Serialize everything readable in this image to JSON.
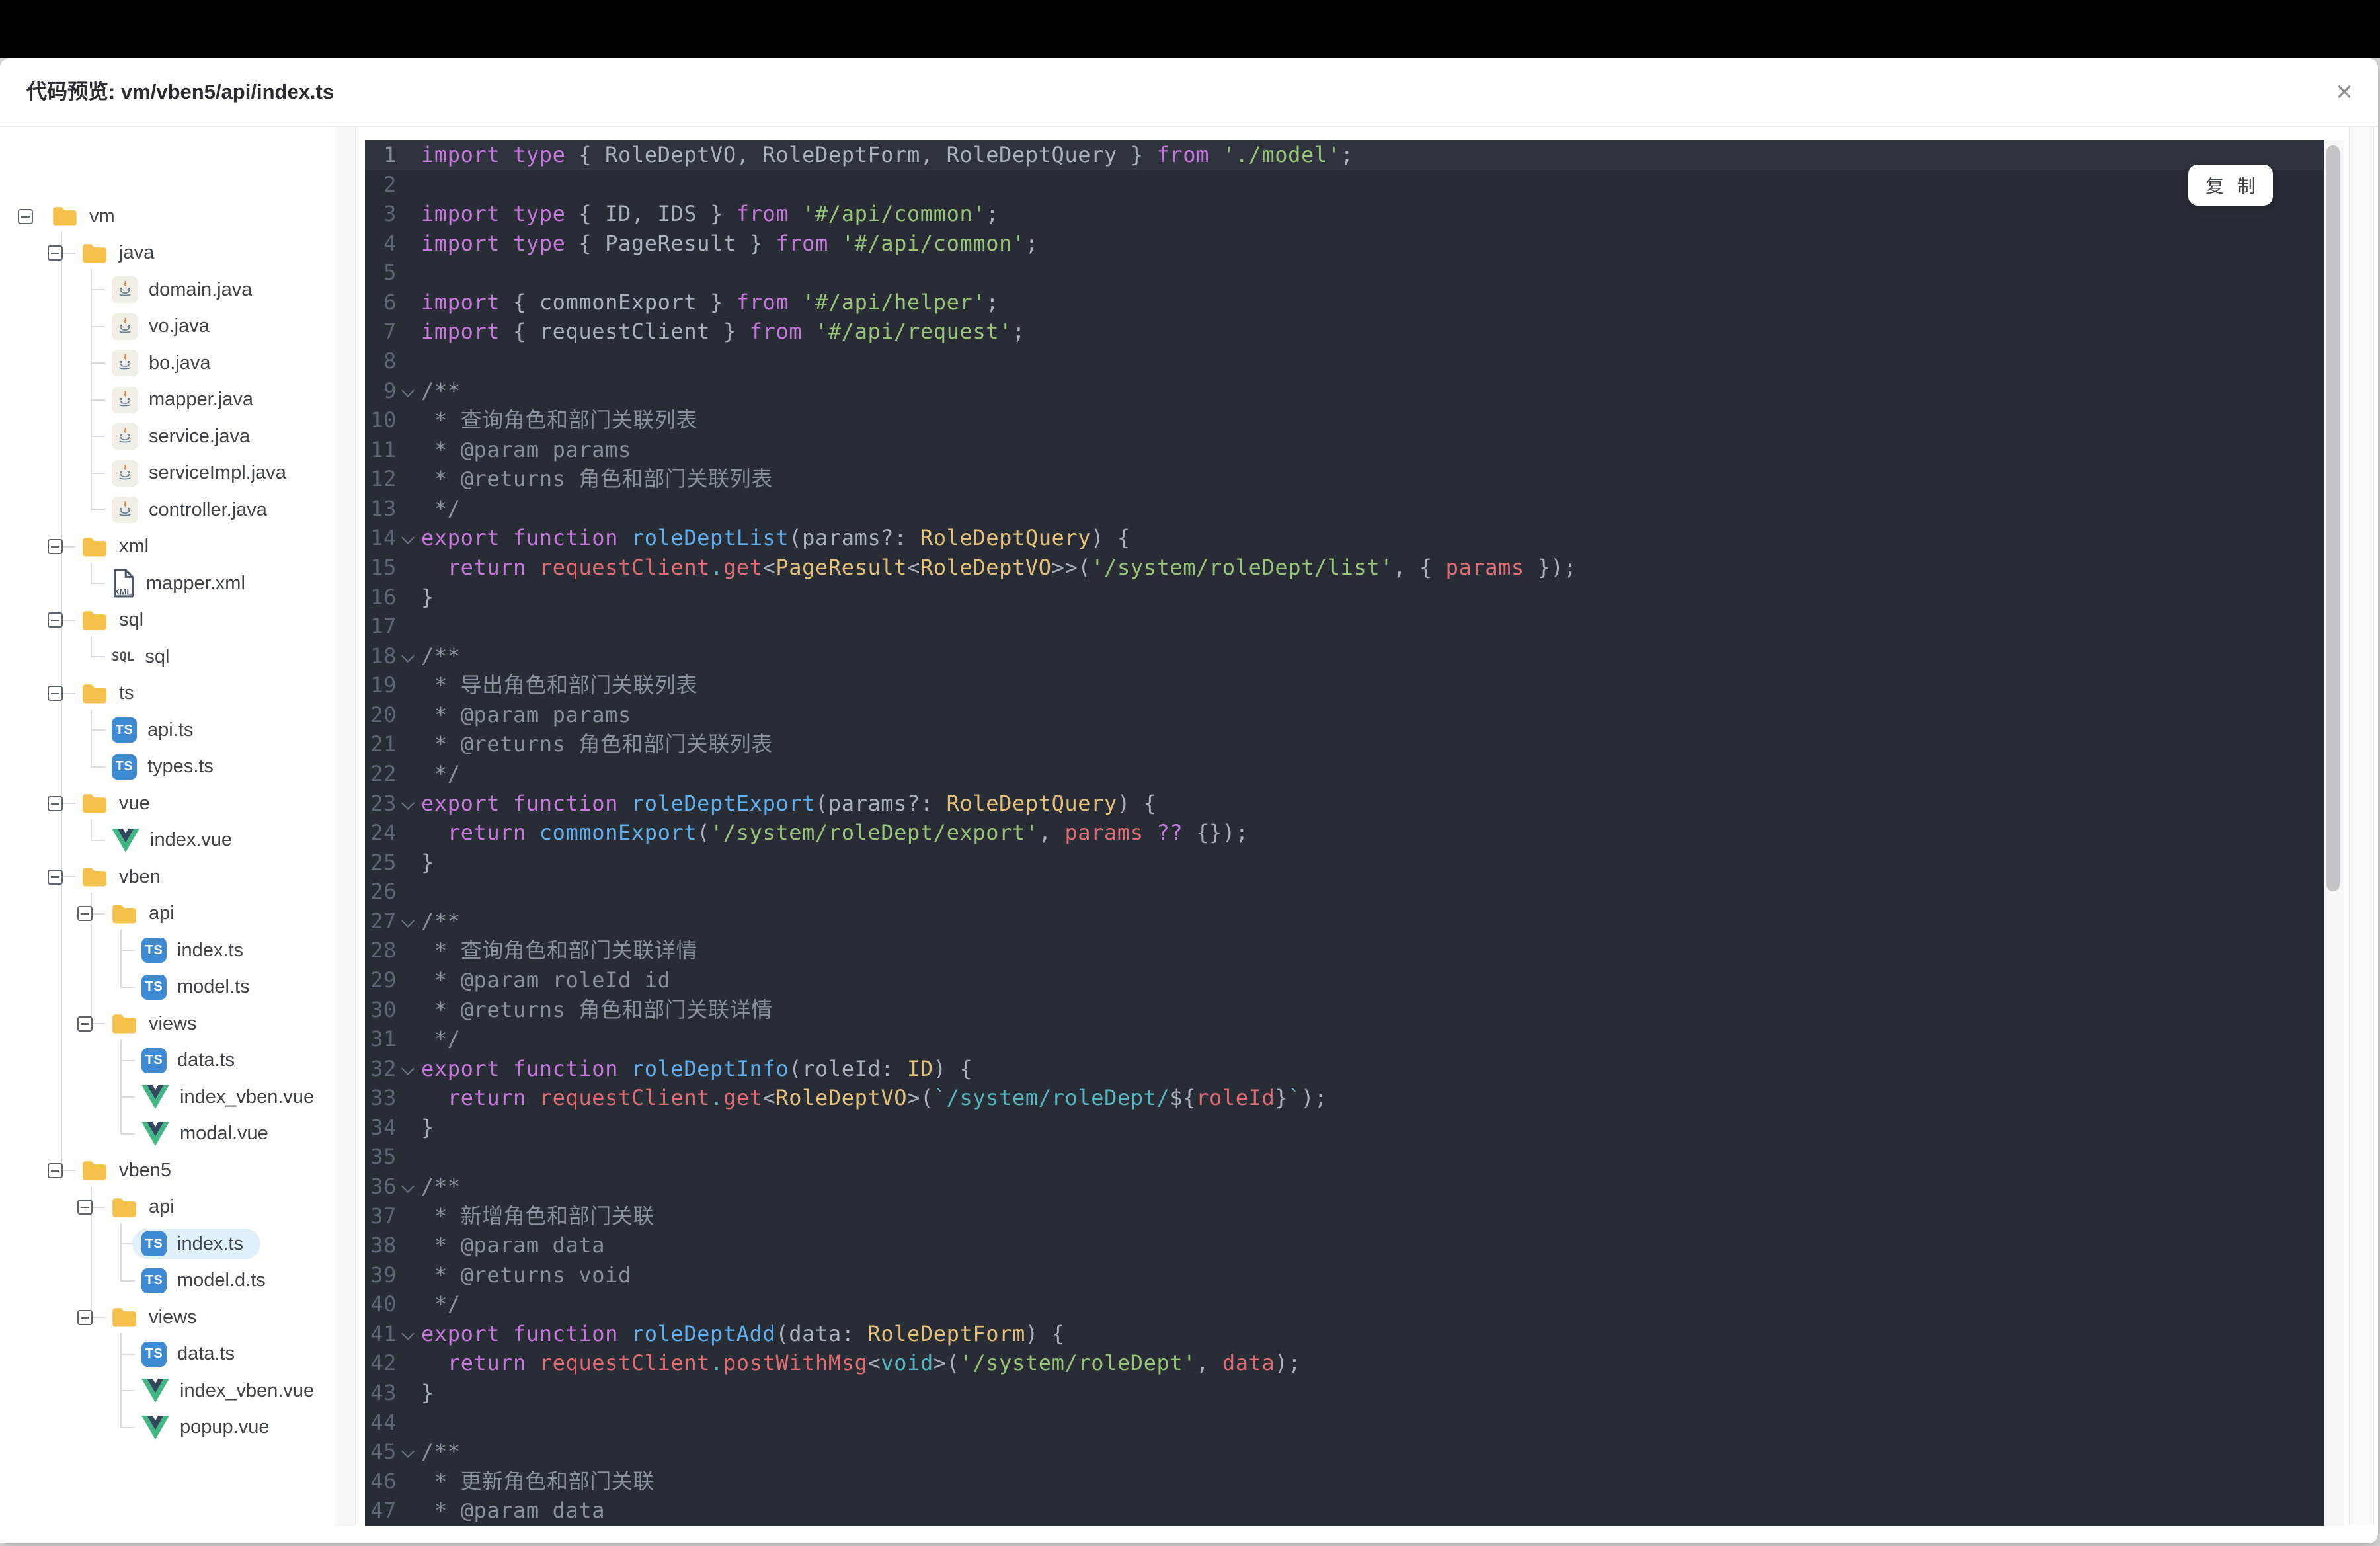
{
  "window": {
    "title": "代码预览: vm/vben5/api/index.ts",
    "close_icon": "×"
  },
  "copy_button": {
    "label": "复 制"
  },
  "colors": {
    "code_bg": "#282c34",
    "code_active_line_bg": "#2e333d",
    "line_number": "#5d6675",
    "selected_row_bg": "#e0f0fd",
    "folder_icon": "#f6c14a",
    "ts_icon": "#3e8ad3",
    "vue_icon_outer": "#41b883",
    "vue_icon_inner": "#35495e",
    "keyword": "#c678dd",
    "function_name": "#61afef",
    "type_name": "#e5c07b",
    "string": "#98c379",
    "template_string": "#56b6c2",
    "property": "#e06c75",
    "plain": "#abb2bf",
    "comment": "#8a919e"
  },
  "tree": {
    "rows": [
      {
        "label": "vm",
        "depth": 0,
        "kind": "folder"
      },
      {
        "label": "java",
        "depth": 1,
        "kind": "folder"
      },
      {
        "label": "domain.java",
        "depth": 2,
        "kind": "java"
      },
      {
        "label": "vo.java",
        "depth": 2,
        "kind": "java"
      },
      {
        "label": "bo.java",
        "depth": 2,
        "kind": "java"
      },
      {
        "label": "mapper.java",
        "depth": 2,
        "kind": "java"
      },
      {
        "label": "service.java",
        "depth": 2,
        "kind": "java"
      },
      {
        "label": "serviceImpl.java",
        "depth": 2,
        "kind": "java"
      },
      {
        "label": "controller.java",
        "depth": 2,
        "kind": "java"
      },
      {
        "label": "xml",
        "depth": 1,
        "kind": "folder"
      },
      {
        "label": "mapper.xml",
        "depth": 2,
        "kind": "xml"
      },
      {
        "label": "sql",
        "depth": 1,
        "kind": "folder"
      },
      {
        "label": "sql",
        "depth": 2,
        "kind": "sql"
      },
      {
        "label": "ts",
        "depth": 1,
        "kind": "folder"
      },
      {
        "label": "api.ts",
        "depth": 2,
        "kind": "ts"
      },
      {
        "label": "types.ts",
        "depth": 2,
        "kind": "ts"
      },
      {
        "label": "vue",
        "depth": 1,
        "kind": "folder"
      },
      {
        "label": "index.vue",
        "depth": 2,
        "kind": "vue"
      },
      {
        "label": "vben",
        "depth": 1,
        "kind": "folder"
      },
      {
        "label": "api",
        "depth": 2,
        "kind": "folder"
      },
      {
        "label": "index.ts",
        "depth": 3,
        "kind": "ts"
      },
      {
        "label": "model.ts",
        "depth": 3,
        "kind": "ts"
      },
      {
        "label": "views",
        "depth": 2,
        "kind": "folder"
      },
      {
        "label": "data.ts",
        "depth": 3,
        "kind": "ts"
      },
      {
        "label": "index_vben.vue",
        "depth": 3,
        "kind": "vue"
      },
      {
        "label": "modal.vue",
        "depth": 3,
        "kind": "vue"
      },
      {
        "label": "vben5",
        "depth": 1,
        "kind": "folder"
      },
      {
        "label": "api",
        "depth": 2,
        "kind": "folder"
      },
      {
        "label": "index.ts",
        "depth": 3,
        "kind": "ts",
        "selected": true
      },
      {
        "label": "model.d.ts",
        "depth": 3,
        "kind": "ts"
      },
      {
        "label": "views",
        "depth": 2,
        "kind": "folder"
      },
      {
        "label": "data.ts",
        "depth": 3,
        "kind": "ts"
      },
      {
        "label": "index_vben.vue",
        "depth": 3,
        "kind": "vue"
      },
      {
        "label": "popup.vue",
        "depth": 3,
        "kind": "vue"
      }
    ]
  },
  "code": {
    "lines": [
      {
        "n": 1,
        "active": true,
        "tokens": [
          [
            "k",
            "import type "
          ],
          [
            "p",
            "{ RoleDeptVO, RoleDeptForm, RoleDeptQuery } "
          ],
          [
            "k",
            "from "
          ],
          [
            "s",
            "'./model'"
          ],
          [
            "p",
            ";"
          ]
        ]
      },
      {
        "n": 2,
        "tokens": []
      },
      {
        "n": 3,
        "tokens": [
          [
            "k",
            "import type "
          ],
          [
            "p",
            "{ ID, IDS } "
          ],
          [
            "k",
            "from "
          ],
          [
            "s",
            "'#/api/common'"
          ],
          [
            "p",
            ";"
          ]
        ]
      },
      {
        "n": 4,
        "tokens": [
          [
            "k",
            "import type "
          ],
          [
            "p",
            "{ PageResult } "
          ],
          [
            "k",
            "from "
          ],
          [
            "s",
            "'#/api/common'"
          ],
          [
            "p",
            ";"
          ]
        ]
      },
      {
        "n": 5,
        "tokens": []
      },
      {
        "n": 6,
        "tokens": [
          [
            "k",
            "import "
          ],
          [
            "p",
            "{ commonExport } "
          ],
          [
            "k",
            "from "
          ],
          [
            "s",
            "'#/api/helper'"
          ],
          [
            "p",
            ";"
          ]
        ]
      },
      {
        "n": 7,
        "tokens": [
          [
            "k",
            "import "
          ],
          [
            "p",
            "{ requestClient } "
          ],
          [
            "k",
            "from "
          ],
          [
            "s",
            "'#/api/request'"
          ],
          [
            "p",
            ";"
          ]
        ]
      },
      {
        "n": 8,
        "tokens": []
      },
      {
        "n": 9,
        "fold": true,
        "tokens": [
          [
            "m",
            "/**"
          ]
        ]
      },
      {
        "n": 10,
        "tokens": [
          [
            "m",
            " * 查询角色和部门关联列表"
          ]
        ]
      },
      {
        "n": 11,
        "tokens": [
          [
            "m",
            " * @param params"
          ]
        ]
      },
      {
        "n": 12,
        "tokens": [
          [
            "m",
            " * @returns 角色和部门关联列表"
          ]
        ]
      },
      {
        "n": 13,
        "tokens": [
          [
            "m",
            " */"
          ]
        ]
      },
      {
        "n": 14,
        "fold": true,
        "tokens": [
          [
            "k",
            "export function "
          ],
          [
            "f",
            "roleDeptList"
          ],
          [
            "p",
            "(params?: "
          ],
          [
            "t",
            "RoleDeptQuery"
          ],
          [
            "p",
            ") {"
          ]
        ]
      },
      {
        "n": 15,
        "tokens": [
          [
            "p",
            "  "
          ],
          [
            "k",
            "return "
          ],
          [
            "r",
            "requestClient"
          ],
          [
            "c",
            "."
          ],
          [
            "r",
            "get"
          ],
          [
            "p",
            "<"
          ],
          [
            "t",
            "PageResult"
          ],
          [
            "p",
            "<"
          ],
          [
            "t",
            "RoleDeptVO"
          ],
          [
            "p",
            ">>("
          ],
          [
            "s",
            "'/system/roleDept/list'"
          ],
          [
            "p",
            ", { "
          ],
          [
            "r",
            "params"
          ],
          [
            "p",
            " });"
          ]
        ]
      },
      {
        "n": 16,
        "tokens": [
          [
            "p",
            "}"
          ]
        ]
      },
      {
        "n": 17,
        "tokens": []
      },
      {
        "n": 18,
        "fold": true,
        "tokens": [
          [
            "m",
            "/**"
          ]
        ]
      },
      {
        "n": 19,
        "tokens": [
          [
            "m",
            " * 导出角色和部门关联列表"
          ]
        ]
      },
      {
        "n": 20,
        "tokens": [
          [
            "m",
            " * @param params"
          ]
        ]
      },
      {
        "n": 21,
        "tokens": [
          [
            "m",
            " * @returns 角色和部门关联列表"
          ]
        ]
      },
      {
        "n": 22,
        "tokens": [
          [
            "m",
            " */"
          ]
        ]
      },
      {
        "n": 23,
        "fold": true,
        "tokens": [
          [
            "k",
            "export function "
          ],
          [
            "f",
            "roleDeptExport"
          ],
          [
            "p",
            "(params?: "
          ],
          [
            "t",
            "RoleDeptQuery"
          ],
          [
            "p",
            ") {"
          ]
        ]
      },
      {
        "n": 24,
        "tokens": [
          [
            "p",
            "  "
          ],
          [
            "k",
            "return "
          ],
          [
            "f",
            "commonExport"
          ],
          [
            "p",
            "("
          ],
          [
            "s",
            "'/system/roleDept/export'"
          ],
          [
            "p",
            ", "
          ],
          [
            "r",
            "params"
          ],
          [
            "p",
            " "
          ],
          [
            "k",
            "??"
          ],
          [
            "p",
            " {});"
          ]
        ]
      },
      {
        "n": 25,
        "tokens": [
          [
            "p",
            "}"
          ]
        ]
      },
      {
        "n": 26,
        "tokens": []
      },
      {
        "n": 27,
        "fold": true,
        "tokens": [
          [
            "m",
            "/**"
          ]
        ]
      },
      {
        "n": 28,
        "tokens": [
          [
            "m",
            " * 查询角色和部门关联详情"
          ]
        ]
      },
      {
        "n": 29,
        "tokens": [
          [
            "m",
            " * @param roleId id"
          ]
        ]
      },
      {
        "n": 30,
        "tokens": [
          [
            "m",
            " * @returns 角色和部门关联详情"
          ]
        ]
      },
      {
        "n": 31,
        "tokens": [
          [
            "m",
            " */"
          ]
        ]
      },
      {
        "n": 32,
        "fold": true,
        "tokens": [
          [
            "k",
            "export function "
          ],
          [
            "f",
            "roleDeptInfo"
          ],
          [
            "p",
            "(roleId: "
          ],
          [
            "t",
            "ID"
          ],
          [
            "p",
            ") {"
          ]
        ]
      },
      {
        "n": 33,
        "tokens": [
          [
            "p",
            "  "
          ],
          [
            "k",
            "return "
          ],
          [
            "r",
            "requestClient"
          ],
          [
            "c",
            "."
          ],
          [
            "r",
            "get"
          ],
          [
            "p",
            "<"
          ],
          [
            "t",
            "RoleDeptVO"
          ],
          [
            "p",
            ">("
          ],
          [
            "c",
            "`/system/roleDept/"
          ],
          [
            "p",
            "${"
          ],
          [
            "r",
            "roleId"
          ],
          [
            "p",
            "}"
          ],
          [
            "c",
            "`"
          ],
          [
            "p",
            ");"
          ]
        ]
      },
      {
        "n": 34,
        "tokens": [
          [
            "p",
            "}"
          ]
        ]
      },
      {
        "n": 35,
        "tokens": []
      },
      {
        "n": 36,
        "fold": true,
        "tokens": [
          [
            "m",
            "/**"
          ]
        ]
      },
      {
        "n": 37,
        "tokens": [
          [
            "m",
            " * 新增角色和部门关联"
          ]
        ]
      },
      {
        "n": 38,
        "tokens": [
          [
            "m",
            " * @param data"
          ]
        ]
      },
      {
        "n": 39,
        "tokens": [
          [
            "m",
            " * @returns void"
          ]
        ]
      },
      {
        "n": 40,
        "tokens": [
          [
            "m",
            " */"
          ]
        ]
      },
      {
        "n": 41,
        "fold": true,
        "tokens": [
          [
            "k",
            "export function "
          ],
          [
            "f",
            "roleDeptAdd"
          ],
          [
            "p",
            "(data: "
          ],
          [
            "t",
            "RoleDeptForm"
          ],
          [
            "p",
            ") {"
          ]
        ]
      },
      {
        "n": 42,
        "tokens": [
          [
            "p",
            "  "
          ],
          [
            "k",
            "return "
          ],
          [
            "r",
            "requestClient"
          ],
          [
            "c",
            "."
          ],
          [
            "r",
            "postWithMsg"
          ],
          [
            "p",
            "<"
          ],
          [
            "c",
            "void"
          ],
          [
            "p",
            ">("
          ],
          [
            "s",
            "'/system/roleDept'"
          ],
          [
            "p",
            ", "
          ],
          [
            "r",
            "data"
          ],
          [
            "p",
            ");"
          ]
        ]
      },
      {
        "n": 43,
        "tokens": [
          [
            "p",
            "}"
          ]
        ]
      },
      {
        "n": 44,
        "tokens": []
      },
      {
        "n": 45,
        "fold": true,
        "tokens": [
          [
            "m",
            "/**"
          ]
        ]
      },
      {
        "n": 46,
        "tokens": [
          [
            "m",
            " * 更新角色和部门关联"
          ]
        ]
      },
      {
        "n": 47,
        "tokens": [
          [
            "m",
            " * @param data"
          ]
        ]
      }
    ]
  }
}
